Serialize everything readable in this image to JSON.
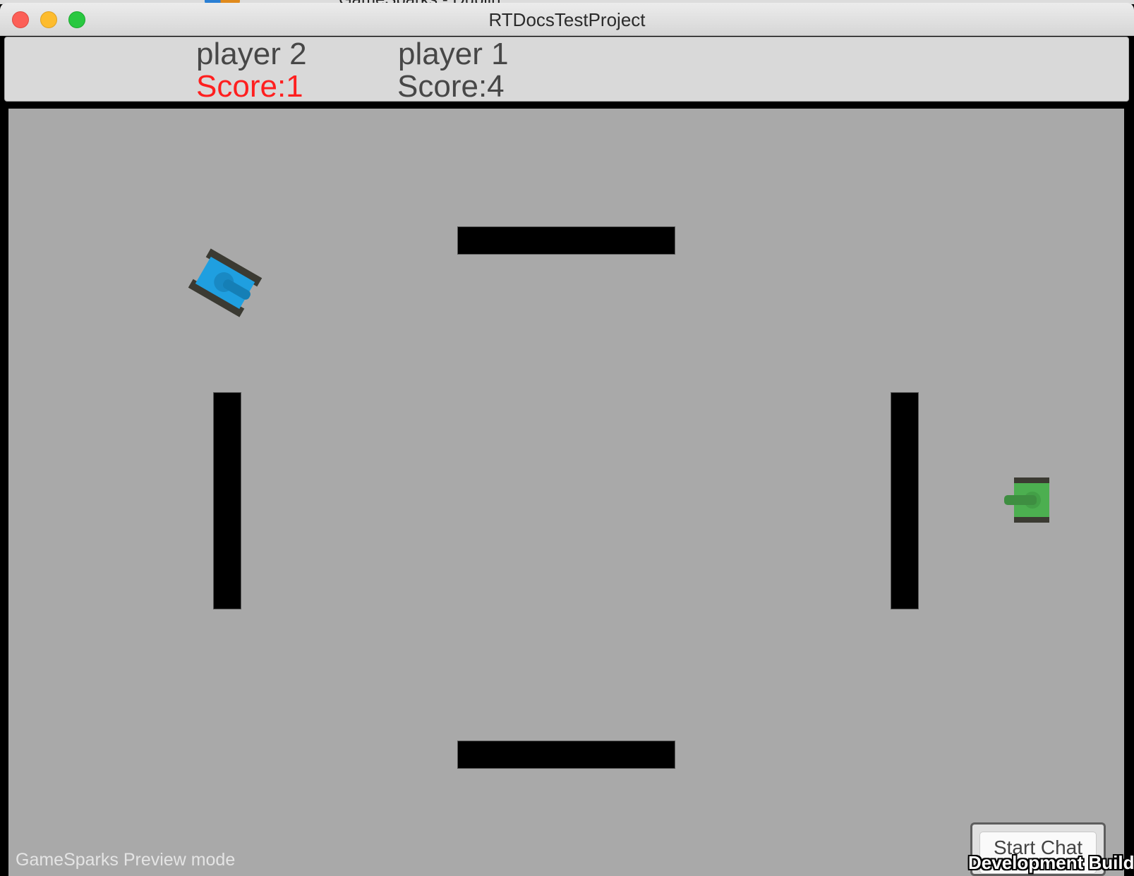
{
  "background_window": {
    "title_fragment": "GameSparks - Dublin"
  },
  "window": {
    "title": "RTDocsTestProject"
  },
  "scoreboard": {
    "players": [
      {
        "name": "player 2",
        "score": "Score:1",
        "score_color": "#ff1f1f"
      },
      {
        "name": "player 1",
        "score": "Score:4",
        "score_color": "#474747"
      }
    ]
  },
  "arena": {
    "background_color": "#a9a9a9",
    "wall_color": "#000000",
    "tanks": [
      {
        "name": "blue-tank",
        "color": "#1f9fe0",
        "orientation": "rotated"
      },
      {
        "name": "green-tank",
        "color": "#4caf50",
        "orientation": "facing-left"
      }
    ]
  },
  "footer": {
    "mode_text": "GameSparks Preview mode",
    "chat_button_label": "Start Chat",
    "build_label": "Development Build"
  }
}
